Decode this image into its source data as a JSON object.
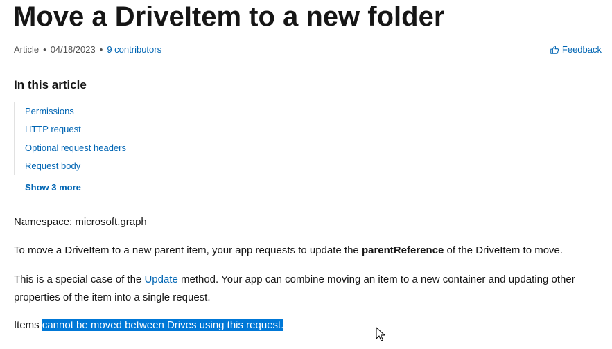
{
  "title": "Move a DriveItem to a new folder",
  "meta": {
    "type": "Article",
    "date": "04/18/2023",
    "contributors": "9 contributors"
  },
  "feedback": {
    "label": "Feedback",
    "icon": "thumbs-up-icon"
  },
  "toc": {
    "heading": "In this article",
    "items": [
      "Permissions",
      "HTTP request",
      "Optional request headers",
      "Request body"
    ],
    "show_more": "Show 3 more"
  },
  "body": {
    "namespace": "Namespace: microsoft.graph",
    "move_para": {
      "before": "To move a DriveItem to a new parent item, your app requests to update the ",
      "bold": "parentReference",
      "after": " of the DriveItem to move."
    },
    "special_para": {
      "before": "This is a special case of the ",
      "link": "Update",
      "after": " method. Your app can combine moving an item to a new container and updating other properties of the item into a single request."
    },
    "items_para": {
      "before": "Items ",
      "selected": "cannot be moved between Drives using this request."
    }
  },
  "colors": {
    "link": "#0065b3",
    "text": "#161616",
    "selection": "#0078d7"
  }
}
